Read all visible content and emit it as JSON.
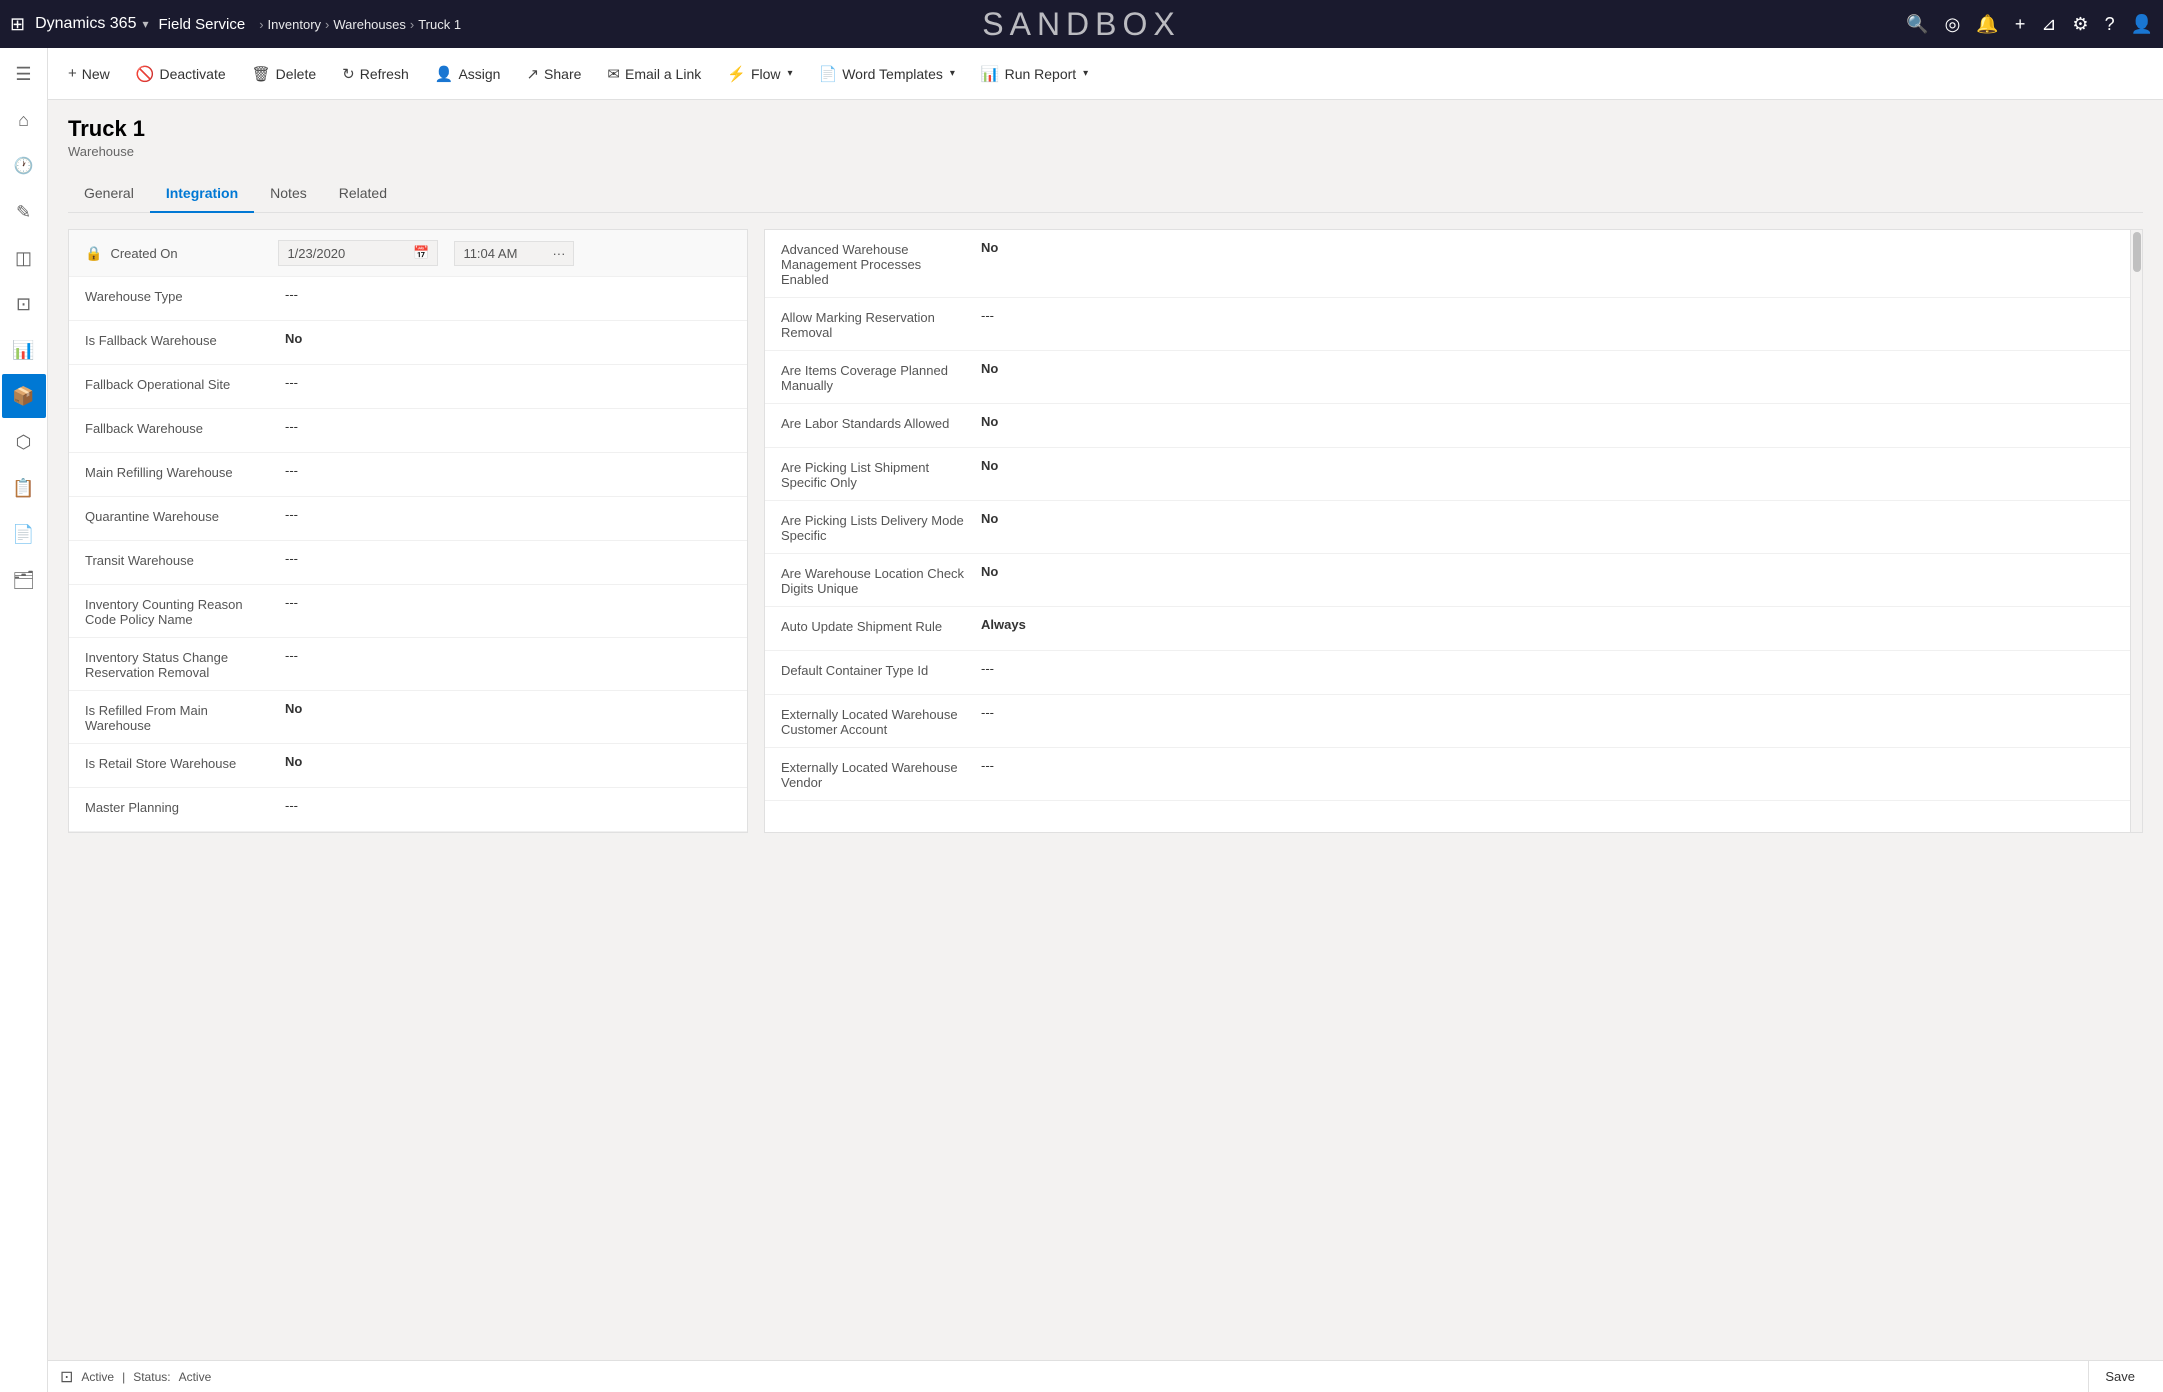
{
  "topNav": {
    "gridIcon": "⊞",
    "brand": "Dynamics 365",
    "chevron": "▾",
    "appName": "Field Service",
    "breadcrumb": [
      "Inventory",
      "Warehouses",
      "Truck 1"
    ],
    "sandboxTitle": "SANDBOX",
    "rightIcons": [
      "🔍",
      "◎",
      "🔔",
      "+",
      "⊿",
      "⚙",
      "?",
      "👤"
    ]
  },
  "sidebar": {
    "items": [
      {
        "icon": "☰",
        "name": "toggle-menu",
        "active": false
      },
      {
        "icon": "⌂",
        "name": "home",
        "active": false
      },
      {
        "icon": "☰",
        "name": "recent",
        "active": false
      },
      {
        "icon": "✎",
        "name": "activities",
        "active": false
      },
      {
        "icon": "◫",
        "name": "notes",
        "active": false
      },
      {
        "icon": "⊡",
        "name": "grid1",
        "active": false
      },
      {
        "icon": "⊞",
        "name": "grid2",
        "active": false
      },
      {
        "icon": "◈",
        "name": "inventory",
        "active": true
      },
      {
        "icon": "⬡",
        "name": "service",
        "active": false
      },
      {
        "icon": "📋",
        "name": "list",
        "active": false
      },
      {
        "icon": "📄",
        "name": "docs",
        "active": false
      },
      {
        "icon": "📦",
        "name": "packages",
        "active": false
      }
    ]
  },
  "commandBar": {
    "buttons": [
      {
        "icon": "+",
        "label": "New",
        "hasChevron": false
      },
      {
        "icon": "🚫",
        "label": "Deactivate",
        "hasChevron": false
      },
      {
        "icon": "🗑",
        "label": "Delete",
        "hasChevron": false
      },
      {
        "icon": "↻",
        "label": "Refresh",
        "hasChevron": false
      },
      {
        "icon": "👤",
        "label": "Assign",
        "hasChevron": false
      },
      {
        "icon": "↗",
        "label": "Share",
        "hasChevron": false
      },
      {
        "icon": "✉",
        "label": "Email a Link",
        "hasChevron": false
      },
      {
        "icon": "⚡",
        "label": "Flow",
        "hasChevron": true
      },
      {
        "icon": "📄",
        "label": "Word Templates",
        "hasChevron": true
      },
      {
        "icon": "📊",
        "label": "Run Report",
        "hasChevron": true
      }
    ]
  },
  "record": {
    "title": "Truck 1",
    "subtitle": "Warehouse"
  },
  "tabs": [
    {
      "label": "General",
      "active": false
    },
    {
      "label": "Integration",
      "active": true
    },
    {
      "label": "Notes",
      "active": false
    },
    {
      "label": "Related",
      "active": false
    }
  ],
  "leftSection": {
    "createdOn": {
      "label": "Created On",
      "date": "1/23/2020",
      "time": "11:04 AM"
    },
    "fields": [
      {
        "label": "Warehouse Type",
        "value": "---",
        "bold": false
      },
      {
        "label": "Is Fallback Warehouse",
        "value": "No",
        "bold": true
      },
      {
        "label": "Fallback Operational Site",
        "value": "---",
        "bold": false
      },
      {
        "label": "Fallback Warehouse",
        "value": "---",
        "bold": false
      },
      {
        "label": "Main Refilling Warehouse",
        "value": "---",
        "bold": false
      },
      {
        "label": "Quarantine Warehouse",
        "value": "---",
        "bold": false
      },
      {
        "label": "Transit Warehouse",
        "value": "---",
        "bold": false
      },
      {
        "label": "Inventory Counting Reason Code Policy Name",
        "value": "---",
        "bold": false
      },
      {
        "label": "Inventory Status Change Reservation Removal",
        "value": "---",
        "bold": false
      },
      {
        "label": "Is Refilled From Main Warehouse",
        "value": "No",
        "bold": true
      },
      {
        "label": "Is Retail Store Warehouse",
        "value": "No",
        "bold": true
      },
      {
        "label": "Master Planning",
        "value": "---",
        "bold": false
      }
    ]
  },
  "rightSection": {
    "fields": [
      {
        "label": "Advanced Warehouse Management Processes Enabled",
        "value": "No",
        "bold": true
      },
      {
        "label": "Allow Marking Reservation Removal",
        "value": "---",
        "bold": false
      },
      {
        "label": "Are Items Coverage Planned Manually",
        "value": "No",
        "bold": true
      },
      {
        "label": "Are Labor Standards Allowed",
        "value": "No",
        "bold": true
      },
      {
        "label": "Are Picking List Shipment Specific Only",
        "value": "No",
        "bold": true
      },
      {
        "label": "Are Picking Lists Delivery Mode Specific",
        "value": "No",
        "bold": true
      },
      {
        "label": "Are Warehouse Location Check Digits Unique",
        "value": "No",
        "bold": true
      },
      {
        "label": "Auto Update Shipment Rule",
        "value": "Always",
        "bold": true
      },
      {
        "label": "Default Container Type Id",
        "value": "---",
        "bold": false
      },
      {
        "label": "Externally Located Warehouse Customer Account",
        "value": "---",
        "bold": false
      },
      {
        "label": "Externally Located Warehouse Vendor",
        "value": "---",
        "bold": false
      }
    ]
  },
  "statusBar": {
    "statusIcon": "●",
    "statusText": "Active",
    "statusLabel": "Status:",
    "statusValue": "Active",
    "saveLabel": "Save"
  }
}
